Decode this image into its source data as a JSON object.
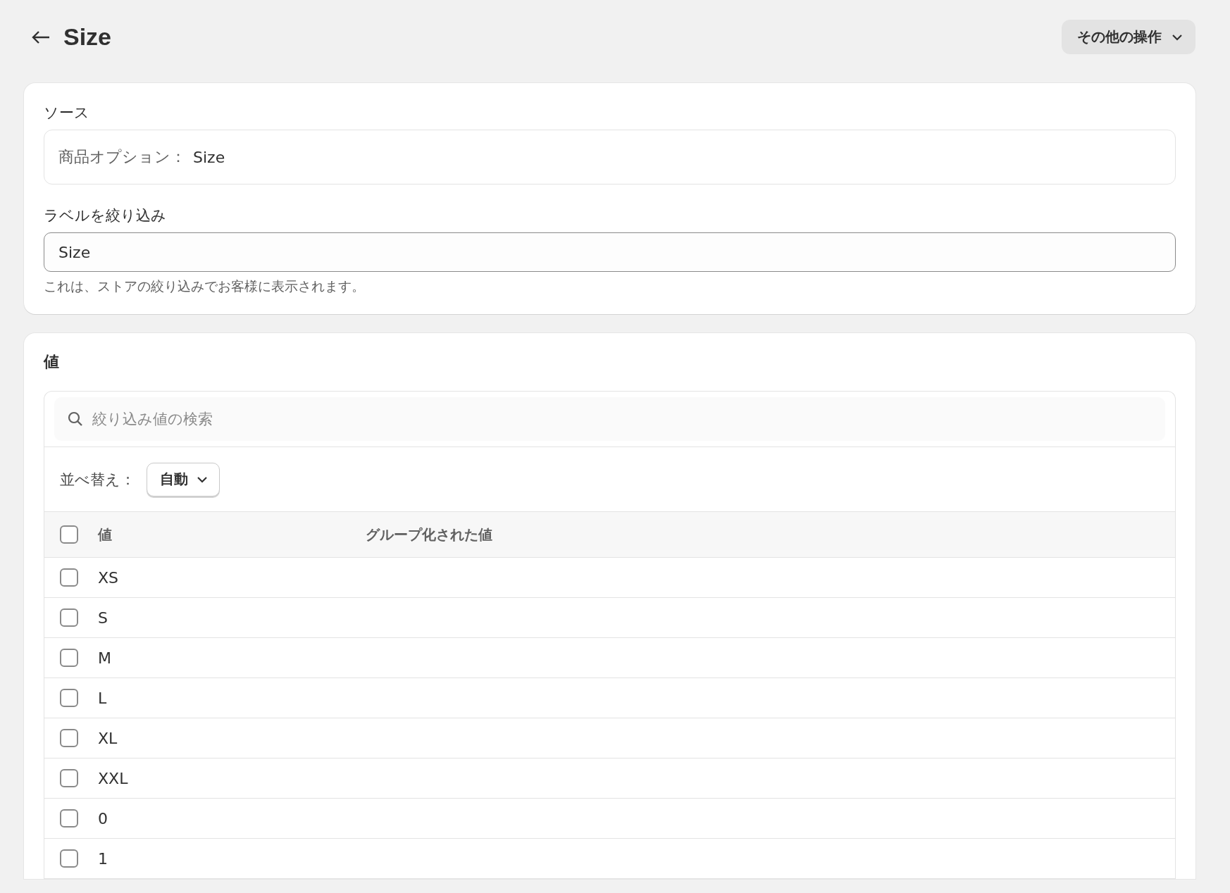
{
  "header": {
    "title": "Size",
    "more_actions": "その他の操作"
  },
  "source_card": {
    "heading": "ソース",
    "source_label": "商品オプション：",
    "source_value": "Size",
    "filter_heading": "ラベルを絞り込み",
    "filter_value": "Size",
    "help_text": "これは、ストアの絞り込みでお客様に表示されます。"
  },
  "values_card": {
    "heading": "値",
    "search": {
      "placeholder": "絞り込み値の検索"
    },
    "sort": {
      "label": "並べ替え：",
      "value": "自動"
    },
    "table": {
      "columns": [
        "値",
        "グループ化された値"
      ],
      "select_all_checked": false,
      "rows": [
        {
          "value": "XS",
          "checked": false
        },
        {
          "value": "S",
          "checked": false
        },
        {
          "value": "M",
          "checked": false
        },
        {
          "value": "L",
          "checked": false
        },
        {
          "value": "XL",
          "checked": false
        },
        {
          "value": "XXL",
          "checked": false
        },
        {
          "value": "0",
          "checked": false
        },
        {
          "value": "1",
          "checked": false
        }
      ]
    }
  }
}
